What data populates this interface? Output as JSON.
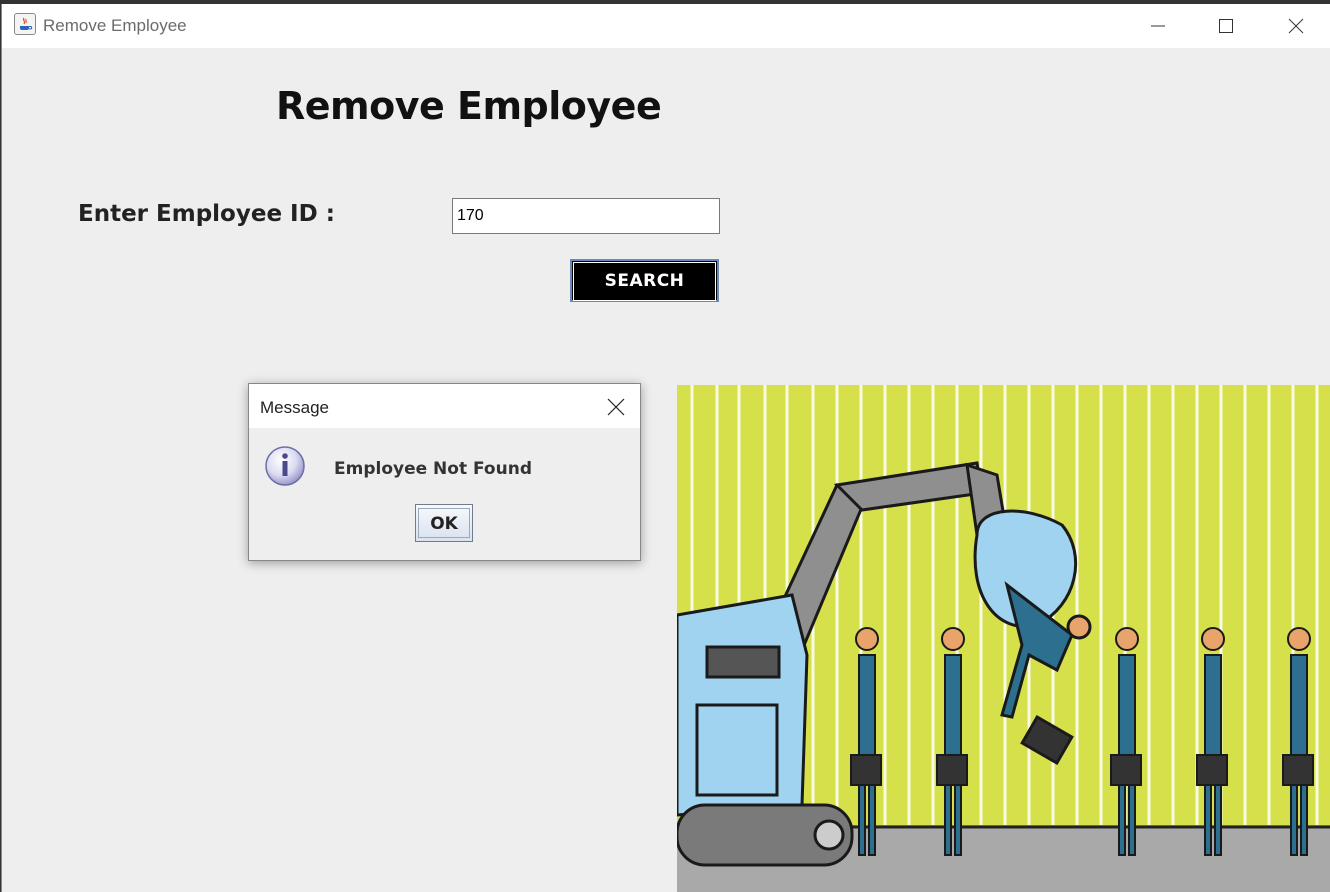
{
  "window": {
    "title": "Remove Employee"
  },
  "form": {
    "heading": "Remove Employee",
    "id_label": "Enter Employee ID :",
    "id_value": "170",
    "search_label": "SEARCH"
  },
  "dialog": {
    "title": "Message",
    "message": "Employee Not Found",
    "ok_label": "OK"
  },
  "colors": {
    "window_bg": "#eeeeee",
    "search_bg": "#000000",
    "illustration_bg": "#d6e04a"
  },
  "icons": [
    "java-app-icon",
    "minimize-icon",
    "maximize-icon",
    "close-icon",
    "info-icon"
  ]
}
